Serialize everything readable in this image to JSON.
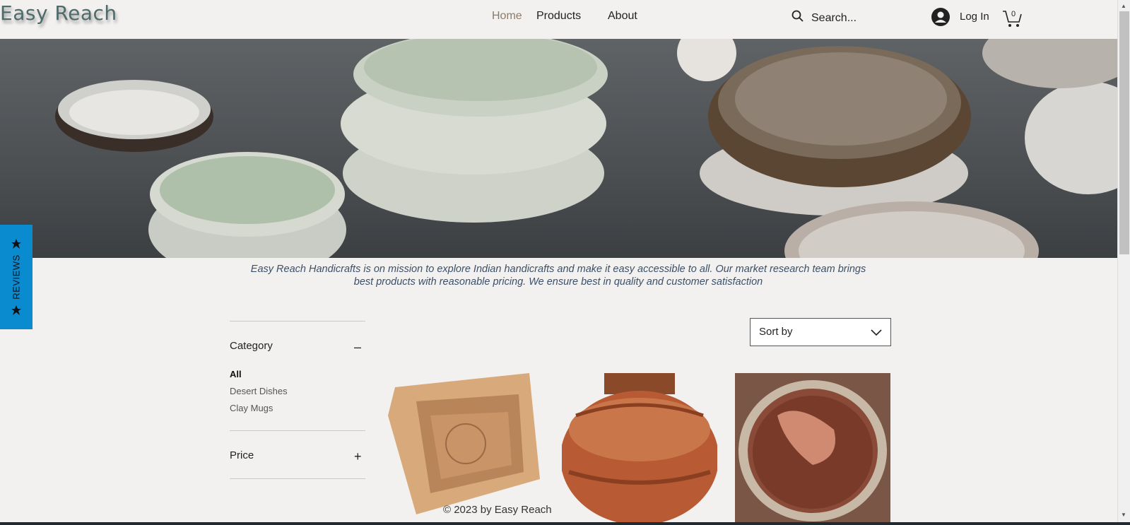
{
  "header": {
    "logo": "Easy Reach",
    "nav": {
      "home": "Home",
      "products": "Products",
      "about": "About"
    },
    "search_placeholder": "Search...",
    "login_label": "Log In",
    "cart_count": "0"
  },
  "hero": {
    "icon": "ceramic-bowls-photo"
  },
  "tagline": {
    "line1": "Easy Reach Handicrafts is on mission to explore Indian handicrafts and make it easy accessible to all.  Our market research team brings",
    "line2": "best products with reasonable pricing. We ensure best in  quality and customer satisfaction"
  },
  "reviews_tab": {
    "label": "REVIEWS",
    "color": "#0a8bd0"
  },
  "filters": {
    "category": {
      "title": "Category",
      "toggle": "–",
      "items": [
        "All",
        "Desert Dishes",
        "Clay Mugs"
      ]
    },
    "price": {
      "title": "Price",
      "toggle": "+"
    }
  },
  "sort": {
    "label": "Sort by"
  },
  "products": [
    {
      "image": "square-clay-dish-photo"
    },
    {
      "image": "terracotta-pot-photo"
    },
    {
      "image": "clay-bowl-photo"
    }
  ],
  "footer": {
    "text": "© 2023 by Easy Reach"
  },
  "colors": {
    "accent_nav": "#8c7b68",
    "logo": "#4e6b6a",
    "tagline": "#3c5068"
  }
}
